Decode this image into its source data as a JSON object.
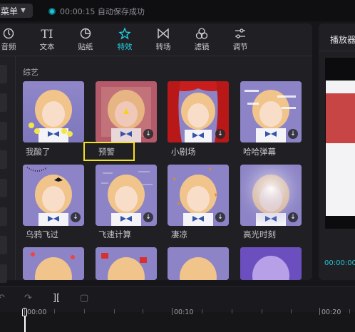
{
  "topbar": {
    "menu_label": "菜单",
    "autosave_text": "00:00:15 自动保存成功"
  },
  "tabs": [
    {
      "label": "音频",
      "icon": "audio-icon"
    },
    {
      "label": "文本",
      "icon": "text-icon"
    },
    {
      "label": "贴纸",
      "icon": "sticker-icon"
    },
    {
      "label": "特效",
      "icon": "effects-icon",
      "active": true
    },
    {
      "label": "转场",
      "icon": "transition-icon"
    },
    {
      "label": "滤镜",
      "icon": "filter-icon"
    },
    {
      "label": "调节",
      "icon": "adjust-icon"
    }
  ],
  "section": {
    "title": "综艺"
  },
  "effects": [
    {
      "label": "我酸了"
    },
    {
      "label": "预警"
    },
    {
      "label": "小剧场"
    },
    {
      "label": "哈哈弹幕"
    },
    {
      "label": "乌鸦飞过"
    },
    {
      "label": "飞速计算"
    },
    {
      "label": "凄凉"
    },
    {
      "label": "高光时刻"
    }
  ],
  "player": {
    "title": "播放器",
    "time": "00:00:00"
  },
  "timeline": {
    "ticks": [
      "00:00",
      "00:10",
      "00:20"
    ]
  },
  "colors": {
    "accent": "#22d3e6",
    "highlight": "#f5e21b"
  }
}
